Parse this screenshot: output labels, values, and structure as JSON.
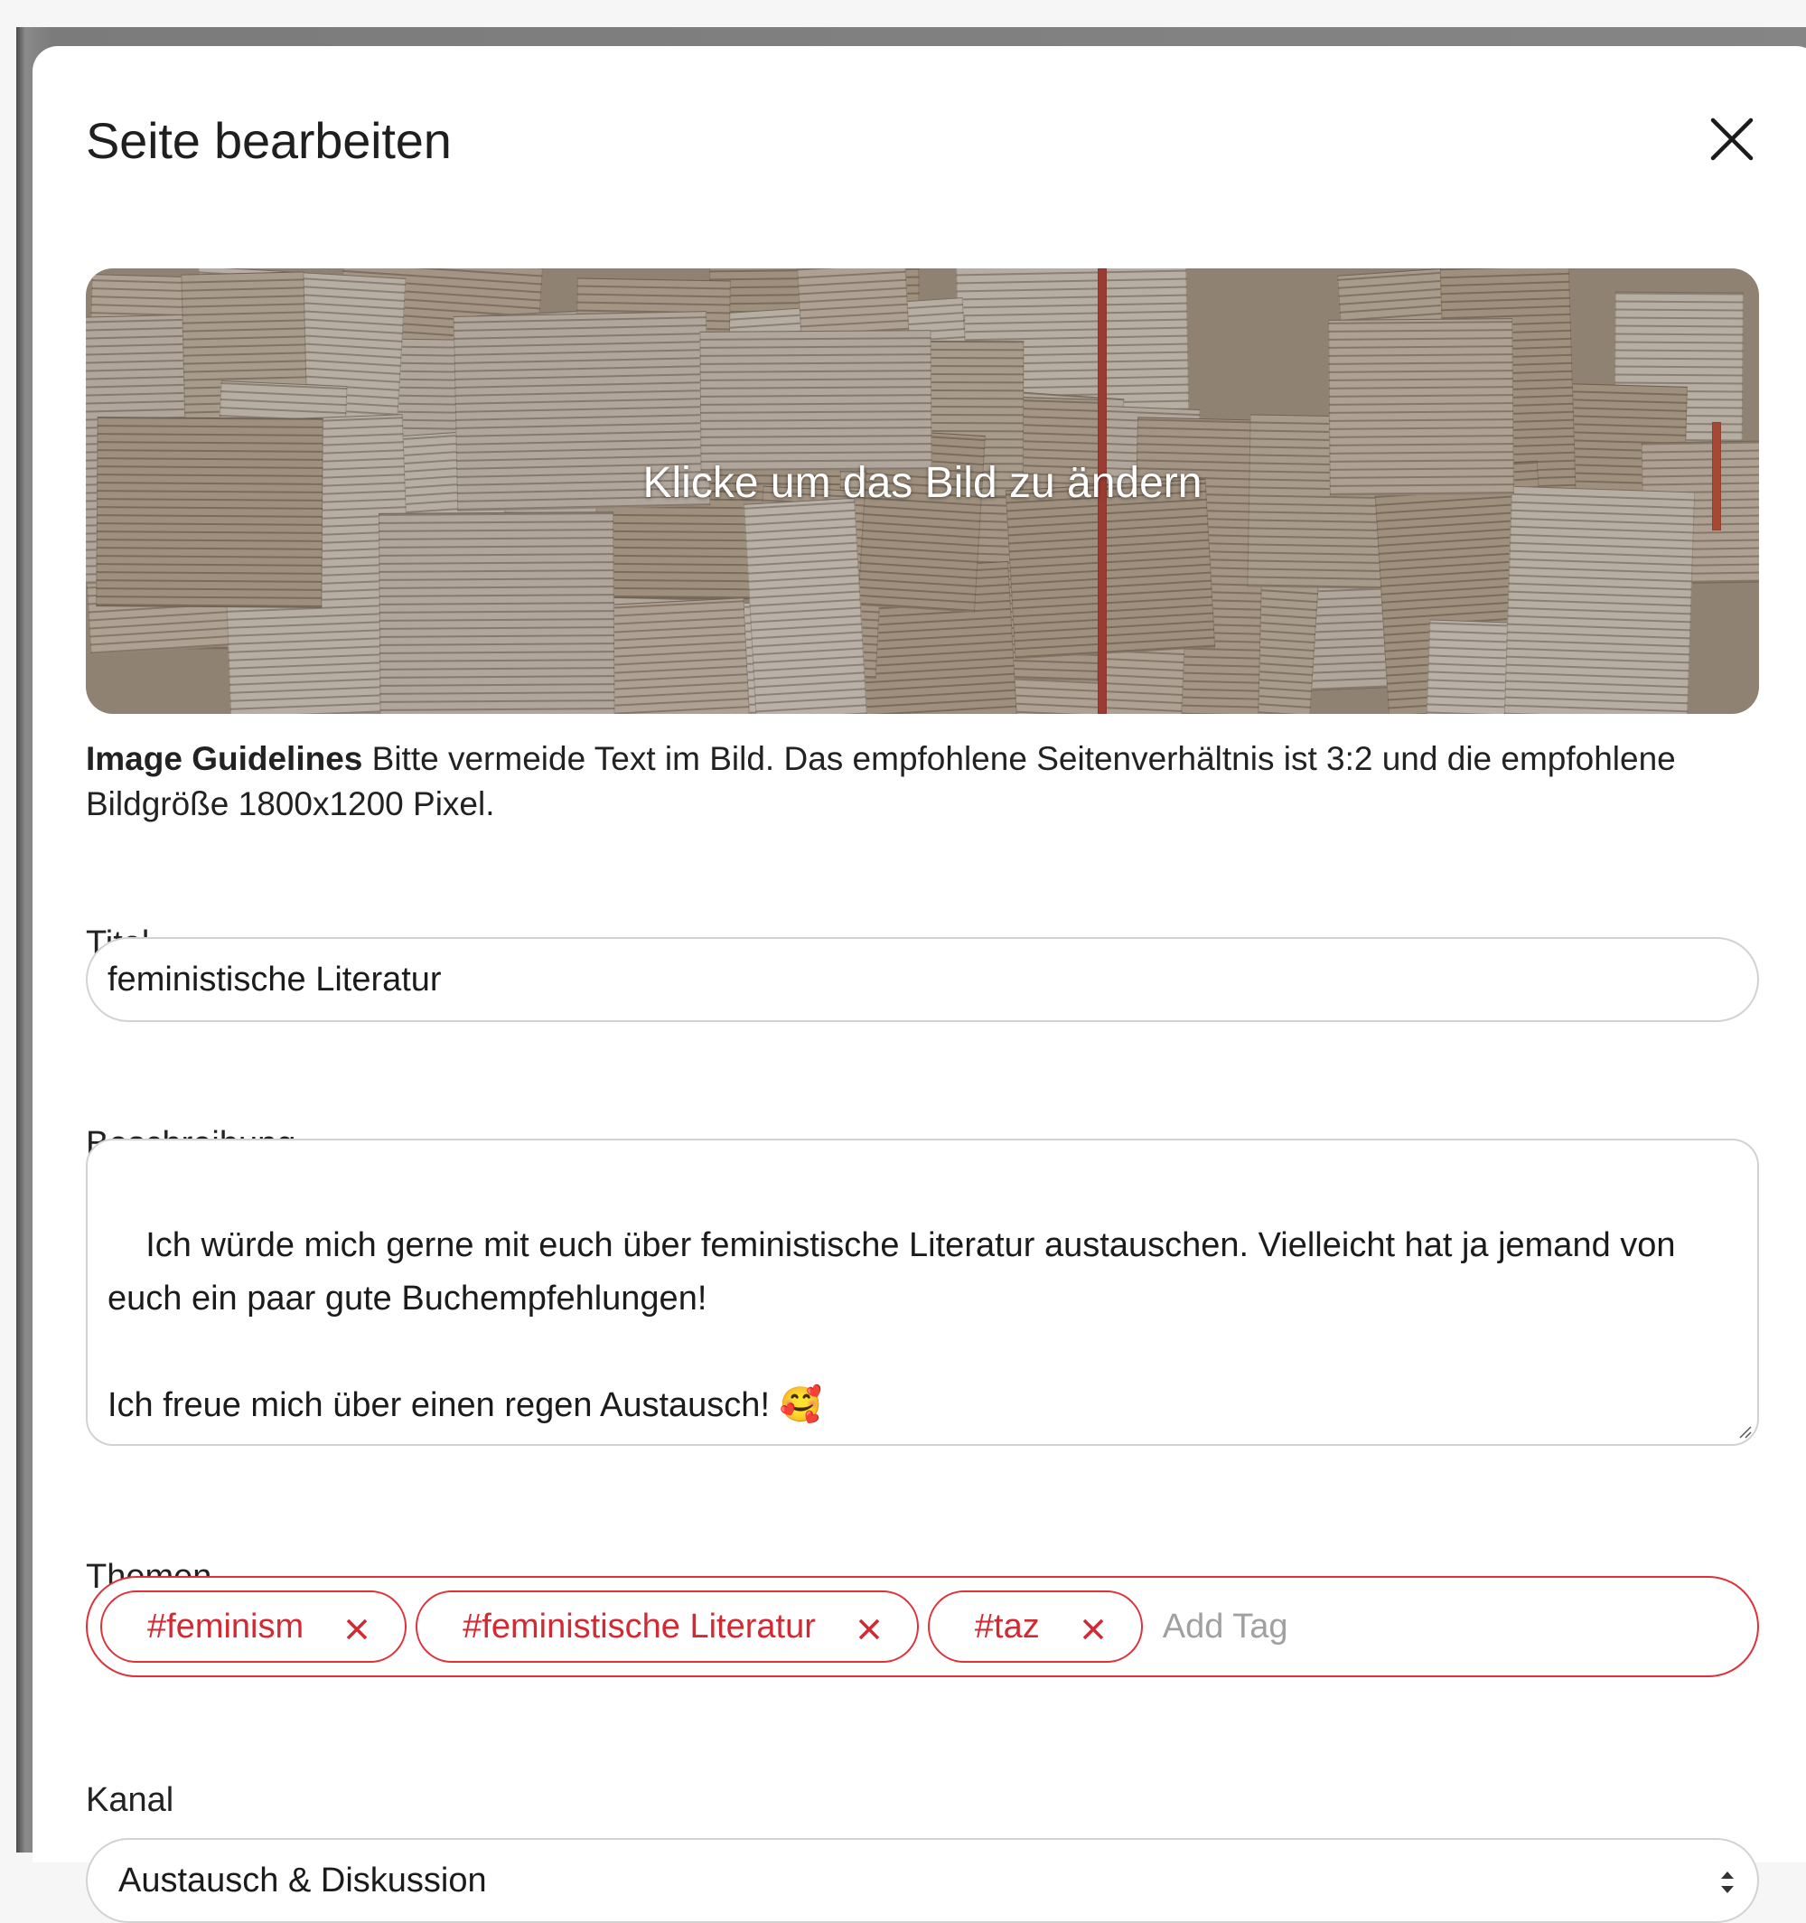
{
  "dialog": {
    "title": "Seite bearbeiten",
    "close_icon": "close-icon"
  },
  "cover": {
    "overlay_text": "Klicke um das Bild zu ändern",
    "image_subject": "open book pages collage"
  },
  "guidelines": {
    "label": "Image Guidelines",
    "text": " Bitte vermeide Text im Bild. Das empfohlene Seitenverhältnis ist 3:2 und die empfohlene Bildgröße 1800x1200 Pixel."
  },
  "title_field": {
    "label": "Titel",
    "value": "feministische Literatur"
  },
  "description_field": {
    "label": "Beschreibung",
    "value": "Ich würde mich gerne mit euch über feministische Literatur austauschen. Vielleicht hat ja jemand von euch ein paar gute Buchempfehlungen!\n\nIch freue mich über einen regen Austausch! 🥰"
  },
  "topics_field": {
    "label": "Themen",
    "tags": [
      "#feminism",
      "#feministische Literatur",
      "#taz"
    ],
    "placeholder": "Add Tag"
  },
  "channel_field": {
    "label": "Kanal",
    "selected": "Austausch & Diskussion"
  },
  "colors": {
    "accent": "#e0313b",
    "border": "#d2d2d2"
  }
}
